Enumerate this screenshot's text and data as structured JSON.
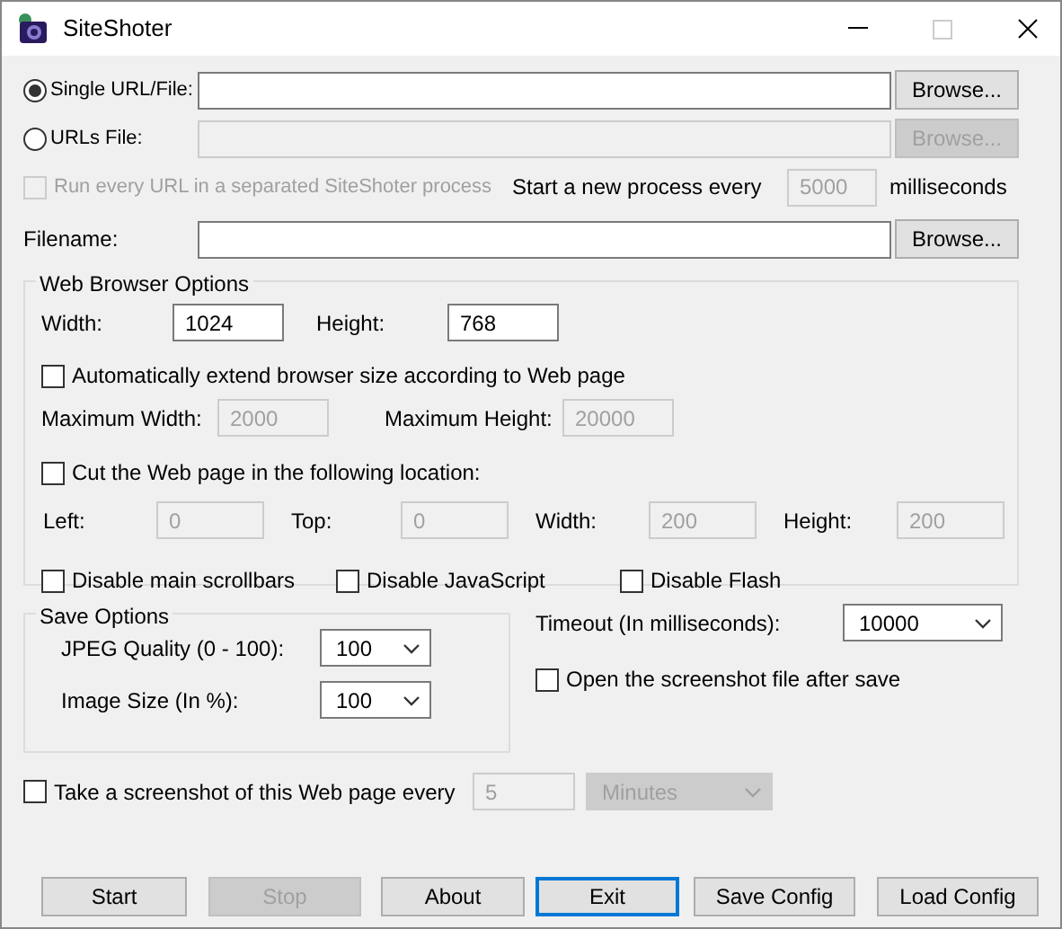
{
  "window": {
    "title": "SiteShoter"
  },
  "sources": [
    {
      "label": "Single URL/File:",
      "selected": true,
      "disabled": false,
      "browse": {
        "label": "Browse...",
        "disabled": false
      }
    },
    {
      "label": "URLs File:",
      "selected": false,
      "disabled": true,
      "browse": {
        "label": "Browse...",
        "disabled": true
      }
    }
  ],
  "separate_process": {
    "label": "Run every URL in a separated SiteShoter process",
    "checked": false,
    "disabled": true,
    "interval_label": "Start a new process every",
    "interval": {
      "value": "5000",
      "disabled": true
    },
    "unit": "milliseconds"
  },
  "filename": {
    "label": "Filename:",
    "browse": {
      "label": "Browse...",
      "disabled": false
    }
  },
  "web_browser_options": {
    "title": "Web Browser Options",
    "size_fields": [
      {
        "label": "Width:",
        "value": "1024",
        "disabled": false
      },
      {
        "label": "Height:",
        "value": "768",
        "disabled": false
      }
    ],
    "auto_extend": {
      "label": "Automatically extend browser size according to Web page",
      "checked": false
    },
    "max_fields": [
      {
        "label": "Maximum Width:",
        "value": "2000",
        "disabled": true
      },
      {
        "label": "Maximum Height:",
        "value": "20000",
        "disabled": true
      }
    ],
    "cut": {
      "label": "Cut the Web page in the following location:",
      "checked": false
    },
    "cut_fields": [
      {
        "label": "Left:",
        "value": "0",
        "disabled": true
      },
      {
        "label": "Top:",
        "value": "0",
        "disabled": true
      },
      {
        "label": "Width:",
        "value": "200",
        "disabled": true
      },
      {
        "label": "Height:",
        "value": "200",
        "disabled": true
      }
    ],
    "toggles": [
      {
        "label": "Disable main scrollbars",
        "checked": false
      },
      {
        "label": "Disable JavaScript",
        "checked": false
      },
      {
        "label": "Disable Flash",
        "checked": false
      }
    ]
  },
  "save_options": {
    "title": "Save Options",
    "dropdowns": [
      {
        "label": "JPEG Quality (0 - 100):",
        "value": "100",
        "disabled": false
      },
      {
        "label": "Image Size (In %):",
        "value": "100",
        "disabled": false
      }
    ]
  },
  "timeout": {
    "label": "Timeout (In milliseconds):",
    "value": "10000",
    "disabled": false
  },
  "open_after_save": {
    "label": "Open the screenshot file after save",
    "checked": false
  },
  "schedule": {
    "label": "Take a screenshot of this Web page every",
    "checked": false,
    "interval": {
      "value": "5",
      "disabled": true
    },
    "unit": {
      "value": "Minutes",
      "disabled": true
    }
  },
  "buttons": [
    {
      "label": "Start",
      "disabled": false,
      "default": false
    },
    {
      "label": "Stop",
      "disabled": true,
      "default": false
    },
    {
      "label": "About",
      "disabled": false,
      "default": false
    },
    {
      "label": "Exit",
      "disabled": false,
      "default": true
    },
    {
      "label": "Save Config",
      "disabled": false,
      "default": false
    },
    {
      "label": "Load Config",
      "disabled": false,
      "default": false
    }
  ]
}
